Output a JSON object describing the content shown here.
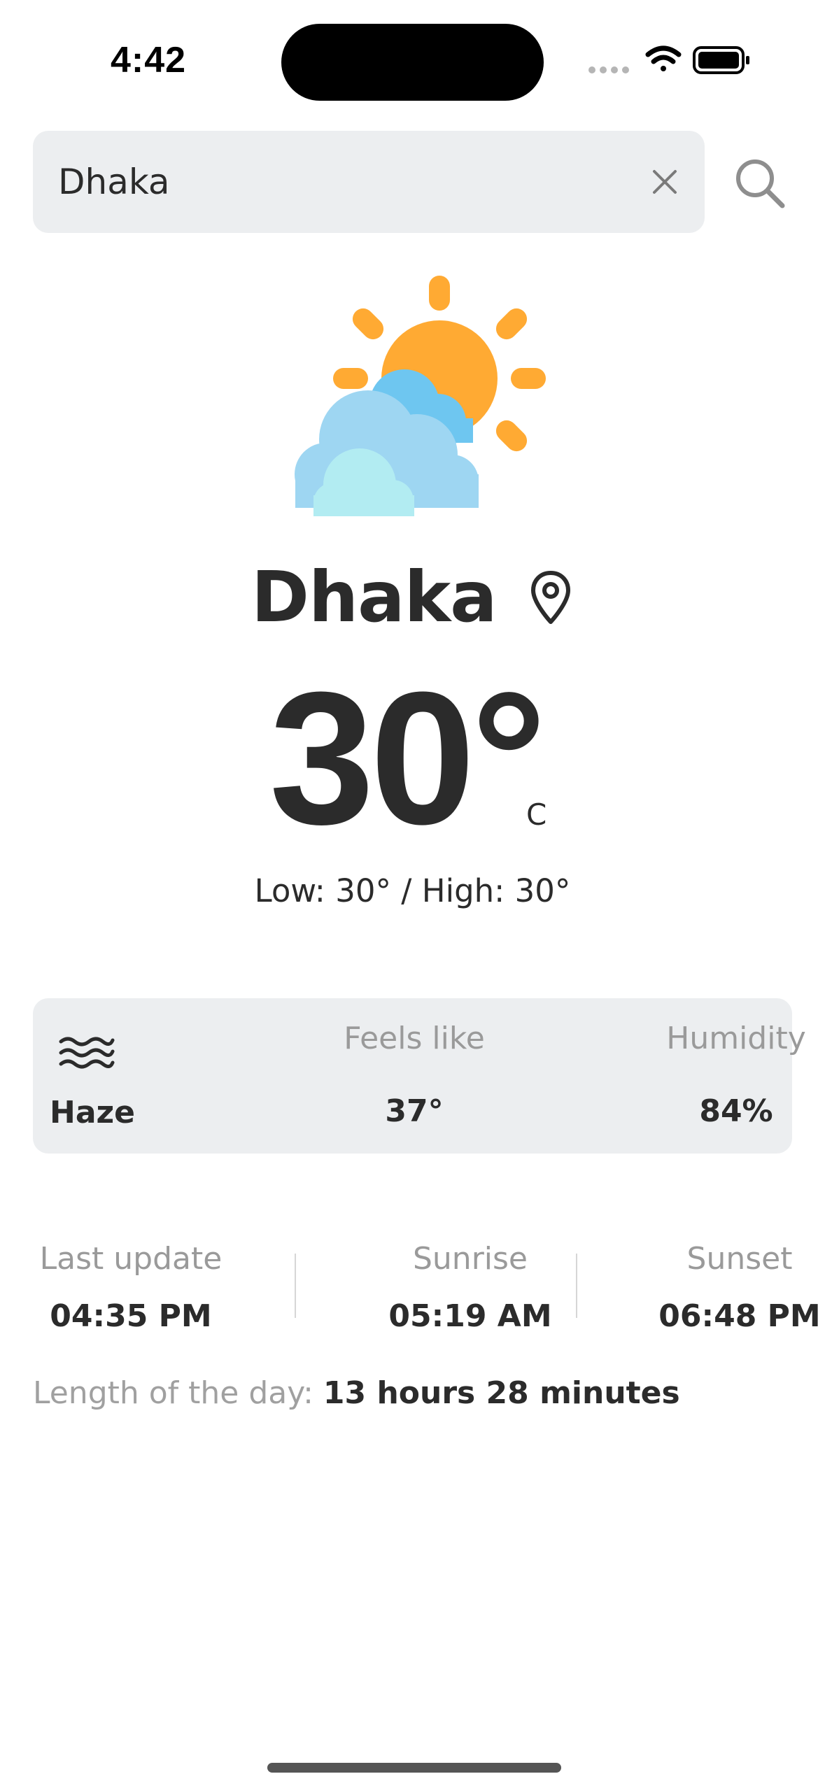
{
  "status_bar": {
    "time": "4:42"
  },
  "search": {
    "value": "Dhaka",
    "clear_icon": "close-icon",
    "search_icon": "search-icon"
  },
  "weather": {
    "icon": "sun-behind-clouds-icon",
    "city": "Dhaka",
    "temperature": "30°",
    "unit": "C",
    "low_high": "Low: 30° / High: 30°"
  },
  "details": {
    "condition_icon": "haze-icon",
    "condition": "Haze",
    "feels_like_label": "Feels like",
    "feels_like_value": "37°",
    "humidity_label": "Humidity",
    "humidity_value": "84%"
  },
  "sun": {
    "last_update_label": "Last update",
    "last_update_value": "04:35 PM",
    "sunrise_label": "Sunrise",
    "sunrise_value": "05:19 AM",
    "sunset_label": "Sunset",
    "sunset_value": "06:48 PM",
    "day_length_label": "Length of the day: ",
    "day_length_value": "13 hours 28 minutes"
  },
  "colors": {
    "sun": "#FFAA33",
    "cloud_back": "#6EC6F0",
    "cloud_front": "#9ED6F2",
    "cloud_small": "#B2ECF2",
    "card_bg": "#ECEEF0",
    "text_dark": "#2B2B2B",
    "text_muted": "#9A9A9A"
  }
}
